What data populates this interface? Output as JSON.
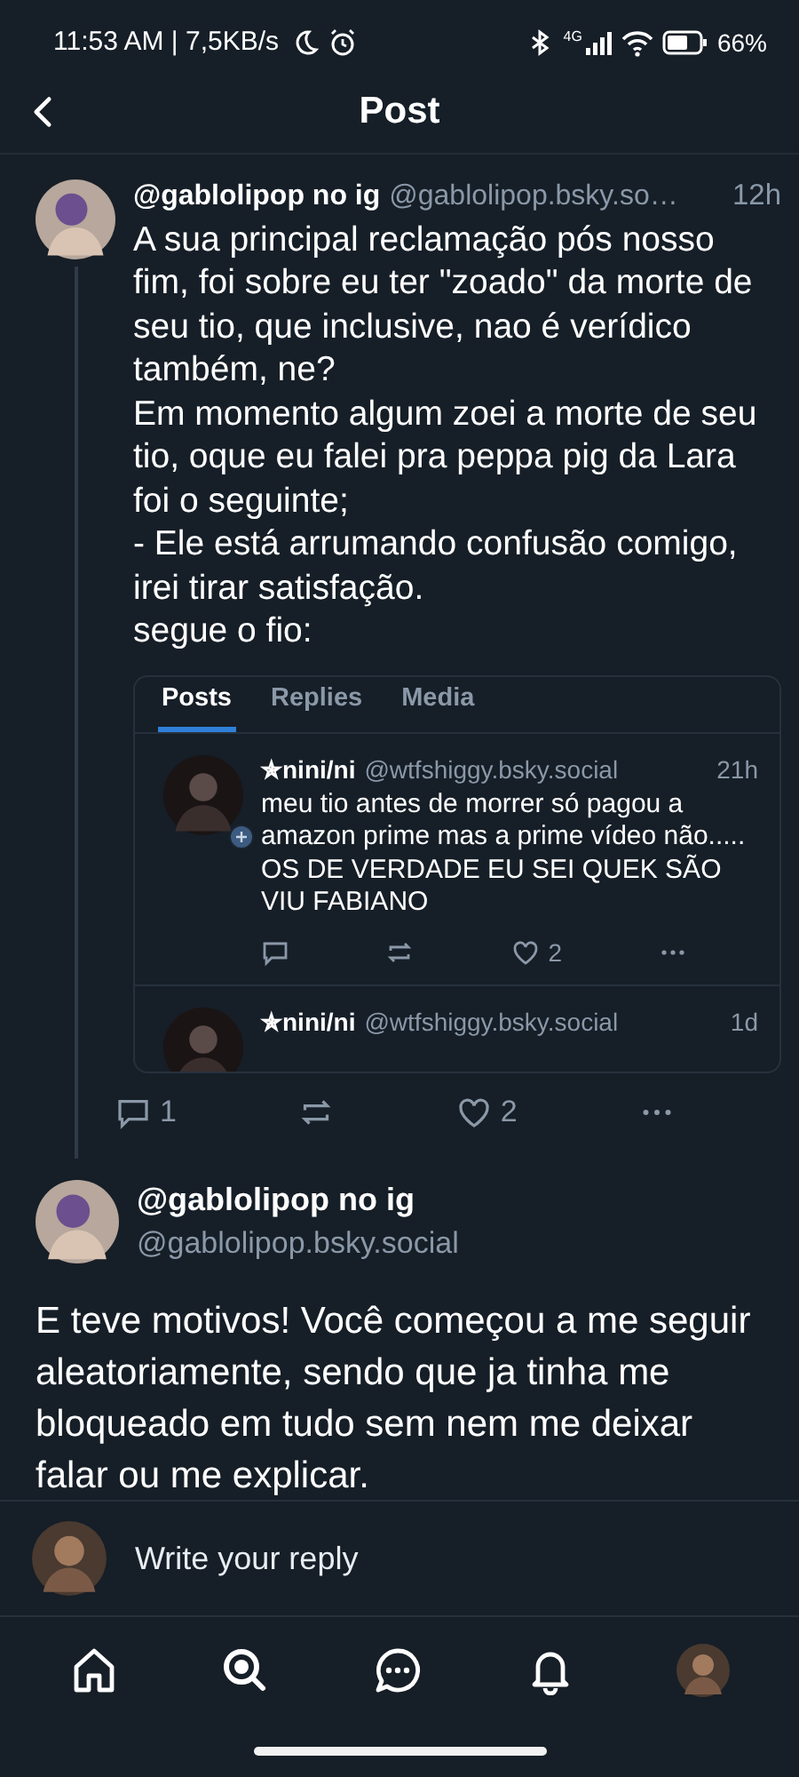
{
  "status_bar": {
    "time": "11:53 AM | 7,5KB/s",
    "network": "4G",
    "battery": "66%"
  },
  "header": {
    "title": "Post"
  },
  "post": {
    "display_name": "@gablolipop no ig",
    "handle": "@gablolipop.bsky.so…",
    "time": "12h",
    "text": "A sua principal reclamação pós nosso fim, foi sobre eu ter \"zoado\" da morte de seu tio, que inclusive, nao é verídico também, ne?\nEm momento algum zoei a morte de seu tio, oque eu falei pra peppa pig da Lara foi o seguinte;\n- Ele está arrumando confusão comigo, irei tirar satisfação.\nsegue o fio:",
    "embed": {
      "tabs": [
        {
          "label": "Posts",
          "selected": true
        },
        {
          "label": "Replies",
          "selected": false
        },
        {
          "label": "Media",
          "selected": false
        }
      ],
      "items": [
        {
          "display_name": "✯nini/ni",
          "handle": "@wtfshiggy.bsky.social",
          "time": "21h",
          "text": "meu tio antes de morrer só pagou a amazon prime mas a prime vídeo não..... OS DE VERDADE EU SEI QUEK SÃO VIU FABIANO",
          "likes": "2"
        },
        {
          "display_name": "✯nini/ni",
          "handle": "@wtfshiggy.bsky.social",
          "time": "1d"
        }
      ]
    },
    "replies": "1",
    "likes": "2"
  },
  "reply": {
    "display_name": "@gablolipop no ig",
    "handle": "@gablolipop.bsky.social",
    "text": "E teve motivos! Você começou a me seguir aleatoriamente, sendo que ja tinha me bloqueado em tudo sem nem me deixar falar ou me explicar."
  },
  "composer": {
    "placeholder": "Write your reply"
  },
  "nav": [
    {
      "kind": "home"
    },
    {
      "kind": "search"
    },
    {
      "kind": "chat"
    },
    {
      "kind": "bell"
    },
    {
      "kind": "profile"
    }
  ]
}
